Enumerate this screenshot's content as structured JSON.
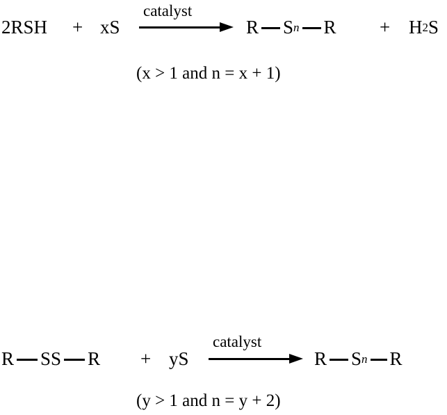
{
  "document": {
    "type": "chemical-reaction-scheme",
    "background_color": "#ffffff",
    "text_color": "#000000",
    "reaction_count": 2
  },
  "reactions": [
    {
      "id": "reaction-1",
      "reactants": {
        "first": "2RSH",
        "plus": "+",
        "second": "xS"
      },
      "arrow": {
        "label": "catalyst",
        "direction": "right"
      },
      "products": {
        "chain_left": "R",
        "chain_center": "S",
        "chain_center_subscript": "n",
        "chain_right": "R",
        "plus": "+",
        "byproduct_element": "H",
        "byproduct_subscript": "2",
        "byproduct_tail": "S"
      },
      "condition": "(x > 1 and n = x + 1)"
    },
    {
      "id": "reaction-2",
      "reactants": {
        "chain_left": "R",
        "chain_center": "SS",
        "chain_right": "R",
        "plus": "+",
        "second": "yS"
      },
      "arrow": {
        "label": "catalyst",
        "direction": "right"
      },
      "products": {
        "chain_left": "R",
        "chain_center": "S",
        "chain_center_subscript": "n",
        "chain_right": "R"
      },
      "condition": "(y > 1 and n = y + 2)"
    }
  ]
}
